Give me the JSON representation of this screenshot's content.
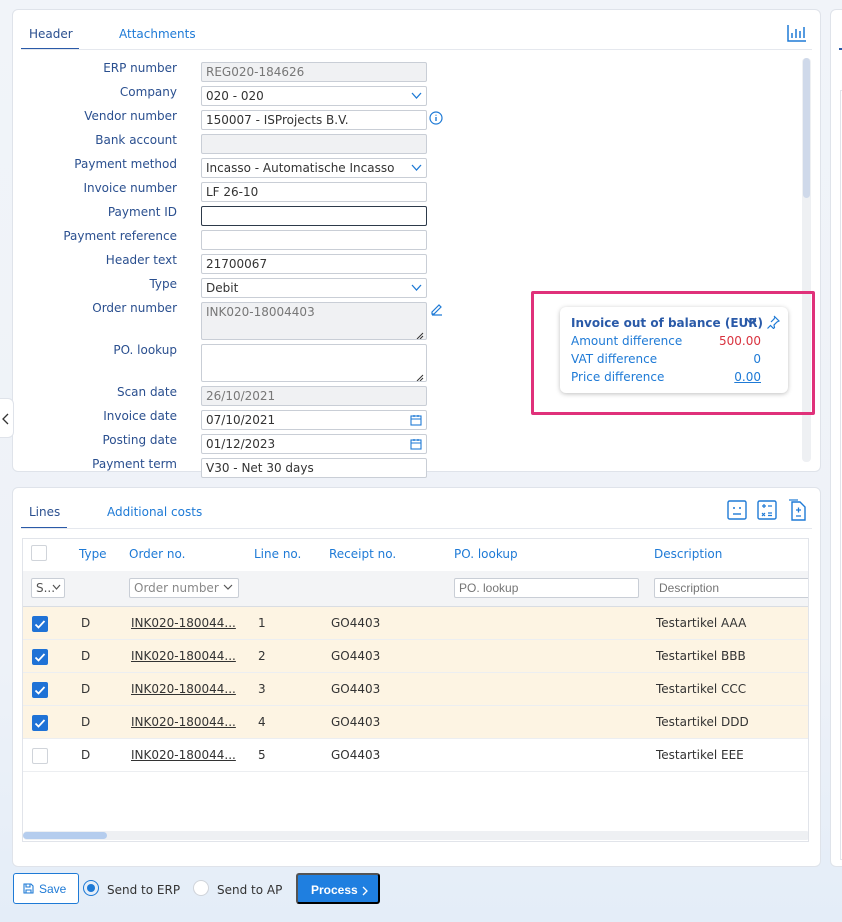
{
  "top_tabs": {
    "header": "Header",
    "attachments": "Attachments"
  },
  "form": [
    {
      "label": "ERP number",
      "value": "REG020-184626",
      "kind": "readonly"
    },
    {
      "label": "Company",
      "value": "020 - 020",
      "kind": "dropdown"
    },
    {
      "label": "Vendor number",
      "value": "150007 - ISProjects B.V.",
      "kind": "text"
    },
    {
      "label": "Bank account",
      "value": "",
      "kind": "readonly"
    },
    {
      "label": "Payment method",
      "value": "Incasso - Automatische Incasso",
      "kind": "dropdown"
    },
    {
      "label": "Invoice number",
      "value": "LF 26-10",
      "kind": "text"
    },
    {
      "label": "Payment ID",
      "value": "",
      "kind": "focus"
    },
    {
      "label": "Payment reference",
      "value": "",
      "kind": "text"
    },
    {
      "label": "Header text",
      "value": "21700067",
      "kind": "text"
    },
    {
      "label": "Type",
      "value": "Debit",
      "kind": "dropdown"
    },
    {
      "label": "Order number",
      "value": "INK020-18004403",
      "kind": "area-ro"
    },
    {
      "label": "PO. lookup",
      "value": "",
      "kind": "area"
    },
    {
      "label": "Scan date",
      "value": "26/10/2021",
      "kind": "readonly"
    },
    {
      "label": "Invoice date",
      "value": "07/10/2021",
      "kind": "date"
    },
    {
      "label": "Posting date",
      "value": "01/12/2023",
      "kind": "date"
    },
    {
      "label": "Payment term",
      "value": "V30 - Net 30 days",
      "kind": "text"
    }
  ],
  "balance": {
    "title": "Invoice out of balance (EUR)",
    "rows": [
      {
        "label": "Amount difference",
        "value": "500.00",
        "color": "#d9333f"
      },
      {
        "label": "VAT difference",
        "value": "0",
        "color": "#1e7ad6"
      },
      {
        "label": "Price difference",
        "value": "0.00",
        "color": "#1e7ad6"
      }
    ]
  },
  "lines_tabs": {
    "lines": "Lines",
    "additional": "Additional costs"
  },
  "grid": {
    "headers": {
      "type": "Type",
      "order": "Order no.",
      "line": "Line no.",
      "receipt": "Receipt no.",
      "po": "PO. lookup",
      "desc": "Description"
    },
    "filters": {
      "select": "S...",
      "order": "Order number",
      "po": "PO. lookup",
      "desc": "Description"
    },
    "rows": [
      {
        "checked": true,
        "type": "D",
        "order": "INK020-180044...",
        "line": "1",
        "receipt": "GO4403",
        "desc": "Testartikel AAA"
      },
      {
        "checked": true,
        "type": "D",
        "order": "INK020-180044...",
        "line": "2",
        "receipt": "GO4403",
        "desc": "Testartikel BBB"
      },
      {
        "checked": true,
        "type": "D",
        "order": "INK020-180044...",
        "line": "3",
        "receipt": "GO4403",
        "desc": "Testartikel CCC"
      },
      {
        "checked": true,
        "type": "D",
        "order": "INK020-180044...",
        "line": "4",
        "receipt": "GO4403",
        "desc": "Testartikel DDD"
      },
      {
        "checked": false,
        "type": "D",
        "order": "INK020-180044...",
        "line": "5",
        "receipt": "GO4403",
        "desc": "Testartikel EEE"
      }
    ]
  },
  "footer": {
    "save": "Save",
    "send_erp": "Send to ERP",
    "send_ap": "Send to AP",
    "process": "Process"
  }
}
